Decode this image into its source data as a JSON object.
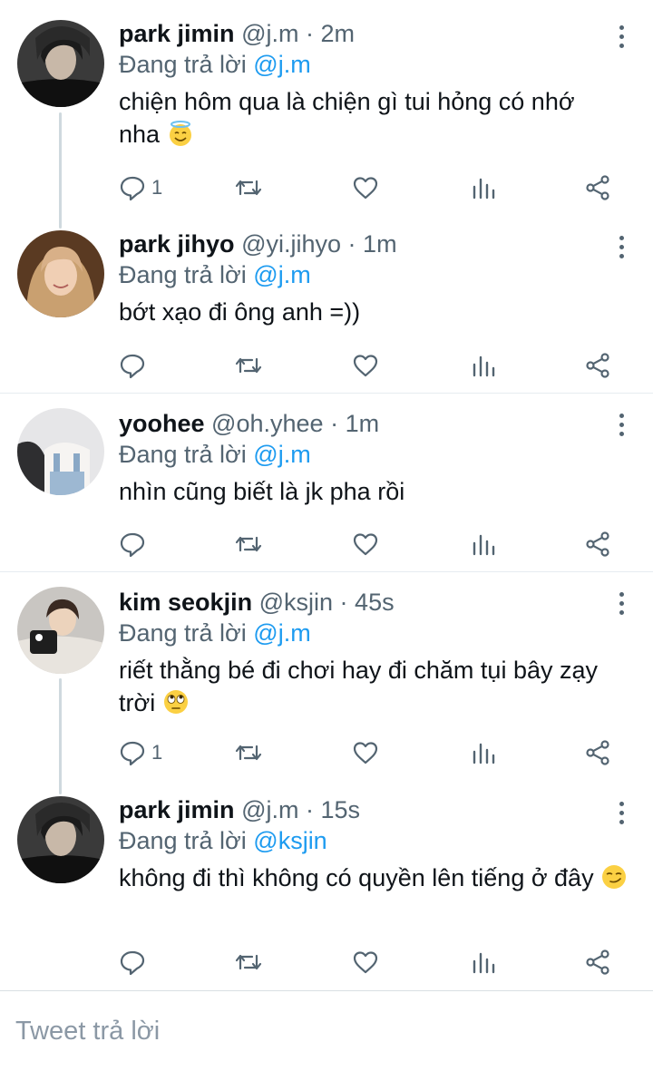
{
  "tweets": [
    {
      "name": "park jimin",
      "handle": "@j.m",
      "sep": "·",
      "time": "2m",
      "reply_prefix": "Đang trả lời",
      "reply_to": "@j.m",
      "text": "chiện hôm qua là chiện gì tui hỏng có nhớ nha",
      "emoji": "smiling-face-with-halo",
      "reply_count": "1"
    },
    {
      "name": "park jihyo",
      "handle": "@yi.jihyo",
      "sep": "·",
      "time": "1m",
      "reply_prefix": "Đang trả lời",
      "reply_to": "@j.m",
      "text": "bớt xạo đi ông anh =))",
      "emoji": "",
      "reply_count": ""
    },
    {
      "name": "yoohee",
      "handle": "@oh.yhee",
      "sep": "·",
      "time": "1m",
      "reply_prefix": "Đang trả lời",
      "reply_to": "@j.m",
      "text": "nhìn cũng biết là jk pha rồi",
      "emoji": "",
      "reply_count": ""
    },
    {
      "name": "kim seokjin",
      "handle": "@ksjin",
      "sep": "·",
      "time": "45s",
      "reply_prefix": "Đang trả lời",
      "reply_to": "@j.m",
      "text": "riết thằng bé đi chơi hay đi chăm tụi bây zạy trời",
      "emoji": "face-with-rolling-eyes",
      "reply_count": "1"
    },
    {
      "name": "park jimin",
      "handle": "@j.m",
      "sep": "·",
      "time": "15s",
      "reply_prefix": "Đang trả lời",
      "reply_to": "@ksjin",
      "text": "không đi thì không có quyền lên tiếng ở đây",
      "emoji": "smirking-face",
      "reply_count": ""
    }
  ],
  "composer": {
    "placeholder": "Tweet trả lời"
  },
  "colors": {
    "mention": "#1d9bf0",
    "secondary_text": "#536471",
    "thread_line": "#cfd9de"
  }
}
